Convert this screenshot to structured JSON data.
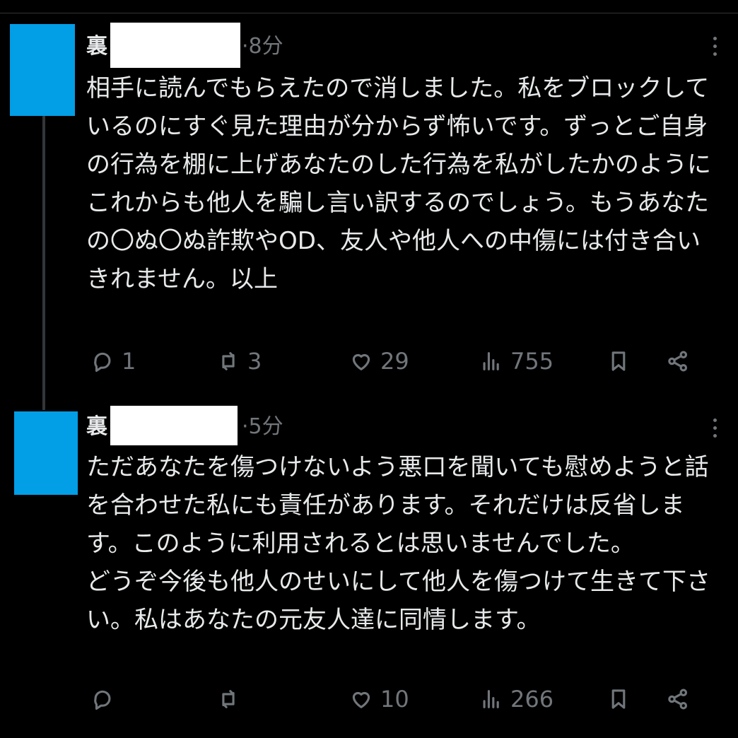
{
  "posts": [
    {
      "name": "裏",
      "time": "·8分",
      "text": "相手に読んでもらえたので消しました。私をブロックしているのにすぐ見た理由が分からず怖いです。ずっとご自身の行為を棚に上げあなたのした行為を私がしたかのようにこれからも他人を騙し言い訳するのでしょう。もうあなたの〇ぬ〇ぬ詐欺やOD、友人や他人への中傷には付き合いきれません。以上",
      "counts": {
        "reply": "1",
        "retweet": "3",
        "like": "29",
        "views": "755"
      }
    },
    {
      "name": "裏",
      "time": "·5分",
      "text": "ただあなたを傷つけないよう悪口を聞いても慰めようと話を合わせた私にも責任があります。それだけは反省します。このように利用されるとは思いませんでした。\nどうぞ今後も他人のせいにして他人を傷つけて生きて下さい。私はあなたの元友人達に同情します。",
      "counts": {
        "reply": "",
        "retweet": "",
        "like": "10",
        "views": "266"
      }
    }
  ],
  "colors": {
    "avatar": "#029ee6",
    "muted": "#71767b",
    "text": "#e7e9ea",
    "background": "#000000"
  },
  "icons": [
    "reply-icon",
    "retweet-icon",
    "like-icon",
    "views-icon",
    "bookmark-icon",
    "share-icon",
    "more-icon"
  ]
}
